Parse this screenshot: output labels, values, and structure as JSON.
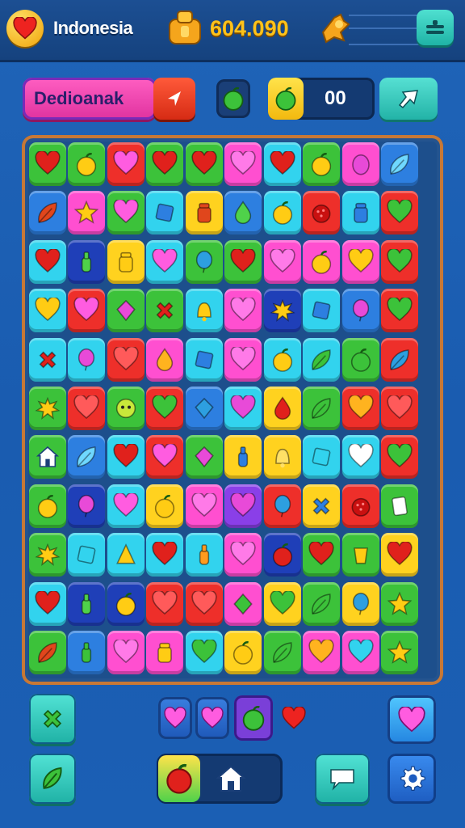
{
  "header": {
    "country": "Indonesia",
    "coins": "604.090",
    "icons": [
      "heart-icon",
      "coin-sack-icon",
      "energy-icon",
      "menu-icon"
    ]
  },
  "toolbar": {
    "level_label": "Dedioanak",
    "moves_value": "00",
    "icons": [
      "arrow-icon",
      "apple-icon",
      "share-icon"
    ]
  },
  "colors": {
    "green": "#3cc23a",
    "yellow": "#ffd21f",
    "red": "#ee2f2a",
    "pink": "#ff4fd0",
    "cyan": "#32d3ee",
    "blue": "#2d7fe0",
    "navy": "#1f3fb8",
    "purple": "#8a3fe8",
    "orange": "#ff9b1f",
    "teal": "#1fc3b0"
  },
  "board": {
    "rows": [
      [
        [
          "green",
          "heart",
          "#e0211c"
        ],
        [
          "green",
          "apple",
          "#ffcc14"
        ],
        [
          "red",
          "heart",
          "#ff5ce0"
        ],
        [
          "green",
          "heart",
          "#e0211c"
        ],
        [
          "green",
          "heart",
          "#e0211c"
        ],
        [
          "pink",
          "heart",
          "#ff7ae8"
        ],
        [
          "cyan",
          "heart",
          "#e0211c"
        ],
        [
          "green",
          "apple",
          "#ffcc14"
        ],
        [
          "pink",
          "blob",
          "#e84ad8"
        ],
        [
          "blue",
          "leaf",
          "#6fd8ff"
        ]
      ],
      [
        [
          "blue",
          "leaf",
          "#e0461c"
        ],
        [
          "pink",
          "star",
          "#ffcc14"
        ],
        [
          "green",
          "heart",
          "#ff5ce0"
        ],
        [
          "cyan",
          "block",
          "#2d7fe0"
        ],
        [
          "yellow",
          "jar",
          "#e0461c"
        ],
        [
          "blue",
          "drop",
          "#4fd24a"
        ],
        [
          "cyan",
          "apple",
          "#ffcc14"
        ],
        [
          "red",
          "berry",
          "#c91010"
        ],
        [
          "cyan",
          "jar",
          "#2d7fe0"
        ],
        [
          "red",
          "heart",
          "#3cc23a"
        ]
      ],
      [
        [
          "cyan",
          "heart",
          "#e0211c"
        ],
        [
          "navy",
          "bottle",
          "#4fd24a"
        ],
        [
          "yellow",
          "jar",
          "#ffcc14"
        ],
        [
          "cyan",
          "heart",
          "#ff5ce0"
        ],
        [
          "green",
          "balloon",
          "#2d9fe0"
        ],
        [
          "green",
          "heart",
          "#e0211c"
        ],
        [
          "pink",
          "heart",
          "#ff7ae8"
        ],
        [
          "pink",
          "apple",
          "#ffcc14"
        ],
        [
          "pink",
          "heart",
          "#ffcc14"
        ],
        [
          "red",
          "heart",
          "#3cc23a"
        ]
      ],
      [
        [
          "cyan",
          "heart",
          "#ffcc14"
        ],
        [
          "red",
          "heart",
          "#ff5ce0"
        ],
        [
          "green",
          "gem",
          "#e84ad8"
        ],
        [
          "green",
          "cross",
          "#e0211c"
        ],
        [
          "cyan",
          "bell",
          "#ffcc14"
        ],
        [
          "pink",
          "heart",
          "#ff7ae8"
        ],
        [
          "navy",
          "splash",
          "#ffcc14"
        ],
        [
          "cyan",
          "block",
          "#2d7fe0"
        ],
        [
          "blue",
          "balloon",
          "#e84ad8"
        ],
        [
          "red",
          "heart",
          "#3cc23a"
        ]
      ],
      [
        [
          "cyan",
          "cross",
          "#e0211c"
        ],
        [
          "cyan",
          "balloon",
          "#e84ad8"
        ],
        [
          "red",
          "heart",
          "#ff5a5a"
        ],
        [
          "pink",
          "drop",
          "#ffb31f"
        ],
        [
          "cyan",
          "block",
          "#2d7fe0"
        ],
        [
          "pink",
          "heart",
          "#ff7ae8"
        ],
        [
          "cyan",
          "apple",
          "#ffcc14"
        ],
        [
          "cyan",
          "leaf",
          "#3cc23a"
        ],
        [
          "green",
          "apple",
          "#3cc23a"
        ],
        [
          "red",
          "leaf",
          "#2d9fe0"
        ]
      ],
      [
        [
          "green",
          "splash",
          "#ffcc14"
        ],
        [
          "red",
          "heart",
          "#ff5a5a"
        ],
        [
          "green",
          "face",
          "#c8e83a"
        ],
        [
          "red",
          "heart",
          "#3cc23a"
        ],
        [
          "blue",
          "gem",
          "#2d9fe0"
        ],
        [
          "cyan",
          "heart",
          "#e84ad8"
        ],
        [
          "yellow",
          "drop",
          "#e0211c"
        ],
        [
          "green",
          "leaf",
          "#3cc23a"
        ],
        [
          "red",
          "heart",
          "#ffb31f"
        ],
        [
          "red",
          "heart",
          "#ff5a5a"
        ]
      ],
      [
        [
          "green",
          "house",
          "#ffffff"
        ],
        [
          "blue",
          "leaf",
          "#6fd8ff"
        ],
        [
          "cyan",
          "heart",
          "#e0211c"
        ],
        [
          "red",
          "heart",
          "#ff5ce0"
        ],
        [
          "green",
          "gem",
          "#e84ad8"
        ],
        [
          "yellow",
          "bottle",
          "#2d7fe0"
        ],
        [
          "yellow",
          "bell",
          "#ffe066"
        ],
        [
          "cyan",
          "block",
          "#32d3ee"
        ],
        [
          "cyan",
          "heart",
          "#ffffff"
        ],
        [
          "red",
          "heart",
          "#3cc23a"
        ]
      ],
      [
        [
          "green",
          "apple",
          "#ffcc14"
        ],
        [
          "navy",
          "balloon",
          "#e84ad8"
        ],
        [
          "cyan",
          "heart",
          "#ff5ce0"
        ],
        [
          "yellow",
          "apple",
          "#ffcc14"
        ],
        [
          "pink",
          "heart",
          "#ff7ae8"
        ],
        [
          "purple",
          "heart",
          "#e84ad8"
        ],
        [
          "red",
          "balloon",
          "#2d9fe0"
        ],
        [
          "yellow",
          "cross",
          "#2d7fe0"
        ],
        [
          "red",
          "berry",
          "#c91010"
        ],
        [
          "green",
          "card",
          "#ffffff"
        ]
      ],
      [
        [
          "green",
          "splash",
          "#ffcc14"
        ],
        [
          "cyan",
          "block",
          "#32d3ee"
        ],
        [
          "cyan",
          "cone",
          "#ffcc14"
        ],
        [
          "cyan",
          "heart",
          "#e0211c"
        ],
        [
          "cyan",
          "bottle",
          "#ff9b1f"
        ],
        [
          "pink",
          "heart",
          "#ff7ae8"
        ],
        [
          "navy",
          "apple",
          "#e0211c"
        ],
        [
          "green",
          "heart",
          "#e0211c"
        ],
        [
          "green",
          "cup",
          "#ffcc14"
        ],
        [
          "yellow",
          "heart",
          "#e0211c"
        ]
      ],
      [
        [
          "cyan",
          "heart",
          "#e0211c"
        ],
        [
          "navy",
          "bottle",
          "#4fd24a"
        ],
        [
          "navy",
          "apple",
          "#ffcc14"
        ],
        [
          "red",
          "heart",
          "#ff5a5a"
        ],
        [
          "red",
          "heart",
          "#ff5a5a"
        ],
        [
          "pink",
          "diamond",
          "#3cc23a"
        ],
        [
          "yellow",
          "heart",
          "#3cc23a"
        ],
        [
          "green",
          "leaf",
          "#3cc23a"
        ],
        [
          "yellow",
          "balloon",
          "#2d9fe0"
        ],
        [
          "green",
          "star",
          "#ffcc14"
        ]
      ],
      [
        [
          "green",
          "leaf",
          "#e0461c"
        ],
        [
          "blue",
          "bottle",
          "#3cc23a"
        ],
        [
          "pink",
          "heart",
          "#ff7ae8"
        ],
        [
          "pink",
          "jar",
          "#ffcc14"
        ],
        [
          "cyan",
          "heart",
          "#3cc23a"
        ],
        [
          "yellow",
          "apple",
          "#ffcc14"
        ],
        [
          "green",
          "leaf",
          "#3cc23a"
        ],
        [
          "pink",
          "heart",
          "#ffb31f"
        ],
        [
          "pink",
          "heart",
          "#32d3ee"
        ],
        [
          "green",
          "star",
          "#ffcc14"
        ]
      ]
    ]
  },
  "footer": {
    "tray_icons": [
      "apple-icon",
      "house-icon"
    ],
    "buttons": [
      "shuffle-button",
      "leaf-button",
      "chat-button",
      "settings-button"
    ]
  }
}
